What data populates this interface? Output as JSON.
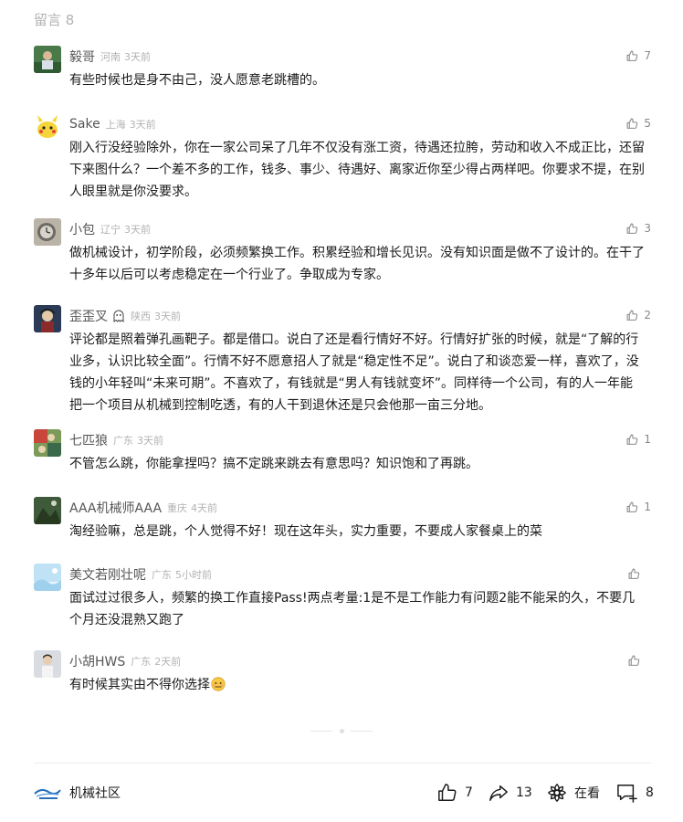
{
  "header": {
    "label": "留言 8"
  },
  "comments": [
    {
      "name": "毅哥",
      "region": "河南",
      "time": "3天前",
      "likes": "7",
      "text": "有些时候也是身不由己，没人愿意老跳槽的。"
    },
    {
      "name": "Sake",
      "region": "上海",
      "time": "3天前",
      "likes": "5",
      "text": "刚入行没经验除外，你在一家公司呆了几年不仅没有涨工资，待遇还拉胯，劳动和收入不成正比，还留下来图什么？一个差不多的工作，钱多、事少、待遇好、离家近你至少得占两样吧。你要求不提，在别人眼里就是你没要求。"
    },
    {
      "name": "小包",
      "region": "辽宁",
      "time": "3天前",
      "likes": "3",
      "text": "做机械设计，初学阶段，必须频繁换工作。积累经验和增长见识。没有知识面是做不了设计的。在干了十多年以后可以考虑稳定在一个行业了。争取成为专家。"
    },
    {
      "name": "歪歪叉",
      "region": "陕西",
      "time": "3天前",
      "likes": "2",
      "text": "评论都是照着弹孔画靶子。都是借口。说白了还是看行情好不好。行情好扩张的时候，就是“了解的行业多，认识比较全面”。行情不好不愿意招人了就是“稳定性不足”。说白了和谈恋爱一样，喜欢了，没钱的小年轻叫“未来可期”。不喜欢了，有钱就是“男人有钱就变坏”。同样待一个公司，有的人一年能把一个项目从机械到控制吃透，有的人干到退休还是只会他那一亩三分地。"
    },
    {
      "name": "七匹狼",
      "region": "广东",
      "time": "3天前",
      "likes": "1",
      "text": "不管怎么跳，你能拿捏吗？搞不定跳来跳去有意思吗？知识饱和了再跳。"
    },
    {
      "name": "AAA机械师AAA",
      "region": "重庆",
      "time": "4天前",
      "likes": "1",
      "text": "淘经验嘛，总是跳，个人觉得不好！现在这年头，实力重要，不要成人家餐桌上的菜"
    },
    {
      "name": "美文若刚壮呢",
      "region": "广东",
      "time": "5小时前",
      "likes": "",
      "text": "面试过过很多人，频繁的换工作直接Pass!两点考量:1是不是工作能力有问题2能不能呆的久，不要几个月还没混熟又跑了"
    },
    {
      "name": "小胡HWS",
      "region": "广东",
      "time": "2天前",
      "likes": "",
      "text": "有时候其实由不得你选择"
    }
  ],
  "footer": {
    "brand_name": "机械社区",
    "like_count": "7",
    "share_count": "13",
    "watching_label": "在看",
    "comment_count": "8"
  },
  "colors": {
    "text_primary": "#1a1a1a",
    "text_secondary": "#555555",
    "text_muted": "#b2b2b2"
  }
}
